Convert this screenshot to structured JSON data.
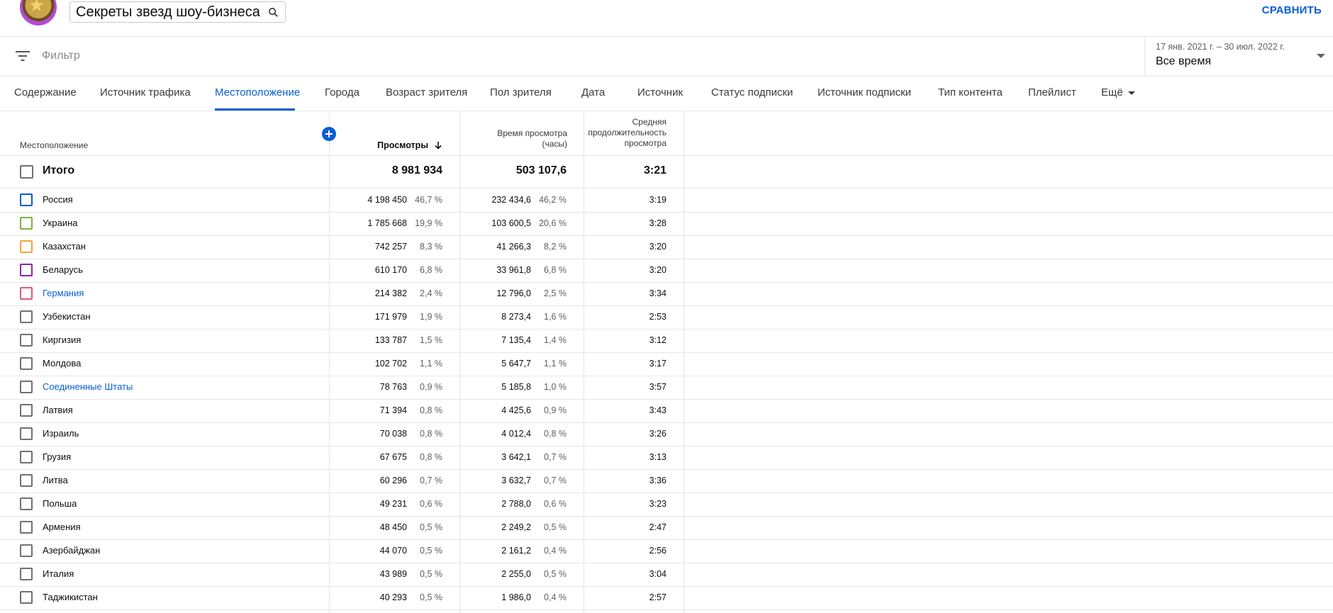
{
  "header": {
    "channel_title": "Секреты звезд шоу-бизнеса",
    "compare_label": "СРАВНИТЬ"
  },
  "filter": {
    "placeholder": "Фильтр",
    "date_range": "17 янв. 2021 г. – 30 июл. 2022 г.",
    "period_label": "Все время"
  },
  "tabs": [
    {
      "label": "Содержание"
    },
    {
      "label": "Источник трафика"
    },
    {
      "label": "Местоположение"
    },
    {
      "label": "Города"
    },
    {
      "label": "Возраст зрителя"
    },
    {
      "label": "Пол зрителя"
    },
    {
      "label": "Дата"
    },
    {
      "label": "Источник"
    },
    {
      "label": "Статус подписки"
    },
    {
      "label": "Источник подписки"
    },
    {
      "label": "Тип контента"
    },
    {
      "label": "Плейлист"
    },
    {
      "label": "Ещё"
    }
  ],
  "active_tab": "Местоположение",
  "columns": {
    "location": "Местоположение",
    "views": "Просмотры",
    "watch_time": "Время просмотра (часы)",
    "avg_duration": "Средняя продолжительность просмотра"
  },
  "total": {
    "label": "Итого",
    "views": "8 981 934",
    "watch_time": "503 107,6",
    "avg_duration": "3:21"
  },
  "rows": [
    {
      "name": "Россия",
      "views": "4 198 450",
      "views_pct": "46,7 %",
      "time": "232 434,6",
      "time_pct": "46,2 %",
      "avg": "3:19",
      "color": "#065fd4",
      "link": false
    },
    {
      "name": "Украина",
      "views": "1 785 668",
      "views_pct": "19,9 %",
      "time": "103 600,5",
      "time_pct": "20,6 %",
      "avg": "3:28",
      "color": "#7cb342",
      "link": false
    },
    {
      "name": "Казахстан",
      "views": "742 257",
      "views_pct": "8,3 %",
      "time": "41 266,3",
      "time_pct": "8,2 %",
      "avg": "3:20",
      "color": "#f2a33a",
      "link": false
    },
    {
      "name": "Беларусь",
      "views": "610 170",
      "views_pct": "6,8 %",
      "time": "33 961,8",
      "time_pct": "6,8 %",
      "avg": "3:20",
      "color": "#8e24aa",
      "link": false
    },
    {
      "name": "Германия",
      "views": "214 382",
      "views_pct": "2,4 %",
      "time": "12 796,0",
      "time_pct": "2,5 %",
      "avg": "3:34",
      "color": "#e0577f",
      "link": true
    },
    {
      "name": "Узбекистан",
      "views": "171 979",
      "views_pct": "1,9 %",
      "time": "8 273,4",
      "time_pct": "1,6 %",
      "avg": "2:53",
      "color": "#717171",
      "link": false
    },
    {
      "name": "Киргизия",
      "views": "133 787",
      "views_pct": "1,5 %",
      "time": "7 135,4",
      "time_pct": "1,4 %",
      "avg": "3:12",
      "color": "#717171",
      "link": false
    },
    {
      "name": "Молдова",
      "views": "102 702",
      "views_pct": "1,1 %",
      "time": "5 647,7",
      "time_pct": "1,1 %",
      "avg": "3:17",
      "color": "#717171",
      "link": false
    },
    {
      "name": "Соединенные Штаты",
      "views": "78 763",
      "views_pct": "0,9 %",
      "time": "5 185,8",
      "time_pct": "1,0 %",
      "avg": "3:57",
      "color": "#717171",
      "link": true
    },
    {
      "name": "Латвия",
      "views": "71 394",
      "views_pct": "0,8 %",
      "time": "4 425,6",
      "time_pct": "0,9 %",
      "avg": "3:43",
      "color": "#717171",
      "link": false
    },
    {
      "name": "Израиль",
      "views": "70 038",
      "views_pct": "0,8 %",
      "time": "4 012,4",
      "time_pct": "0,8 %",
      "avg": "3:26",
      "color": "#717171",
      "link": false
    },
    {
      "name": "Грузия",
      "views": "67 675",
      "views_pct": "0,8 %",
      "time": "3 642,1",
      "time_pct": "0,7 %",
      "avg": "3:13",
      "color": "#717171",
      "link": false
    },
    {
      "name": "Литва",
      "views": "60 296",
      "views_pct": "0,7 %",
      "time": "3 632,7",
      "time_pct": "0,7 %",
      "avg": "3:36",
      "color": "#717171",
      "link": false
    },
    {
      "name": "Польша",
      "views": "49 231",
      "views_pct": "0,6 %",
      "time": "2 788,0",
      "time_pct": "0,6 %",
      "avg": "3:23",
      "color": "#717171",
      "link": false
    },
    {
      "name": "Армения",
      "views": "48 450",
      "views_pct": "0,5 %",
      "time": "2 249,2",
      "time_pct": "0,5 %",
      "avg": "2:47",
      "color": "#717171",
      "link": false
    },
    {
      "name": "Азербайджан",
      "views": "44 070",
      "views_pct": "0,5 %",
      "time": "2 161,2",
      "time_pct": "0,4 %",
      "avg": "2:56",
      "color": "#717171",
      "link": false
    },
    {
      "name": "Италия",
      "views": "43 989",
      "views_pct": "0,5 %",
      "time": "2 255,0",
      "time_pct": "0,5 %",
      "avg": "3:04",
      "color": "#717171",
      "link": false
    },
    {
      "name": "Таджикистан",
      "views": "40 293",
      "views_pct": "0,5 %",
      "time": "1 986,0",
      "time_pct": "0,4 %",
      "avg": "2:57",
      "color": "#717171",
      "link": false
    }
  ]
}
